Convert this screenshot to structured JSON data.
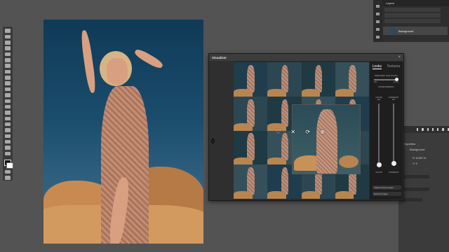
{
  "layers_panel": {
    "tab": "Layers",
    "layer_name": "Background"
  },
  "visualizer": {
    "title": "Visualizer",
    "tabs": [
      "Looks",
      "Textures"
    ],
    "active_tab": "Looks",
    "preview_label": "PREVIEW OUR PICKS",
    "slider_left": "Mild",
    "slider_right": "Strong",
    "randomness_label": "RANDOMNESS",
    "color_label": "COLOR",
    "contrast_label": "CONTRAST",
    "color_top": "low",
    "contrast_top": "low",
    "color_bottom": "COLOR",
    "contrast_bottom": "CONTRAST",
    "buttons": [
      "Import Current Layer",
      "Refresh Image"
    ],
    "overlay_icons": [
      "heart-icon",
      "shuffle-icon",
      "refresh-icon",
      "add-icon"
    ]
  },
  "properties_panel": {
    "title": "Properties",
    "subtitle": "Background",
    "fields": [
      "H: 8.837 in",
      "Y: 0"
    ]
  }
}
